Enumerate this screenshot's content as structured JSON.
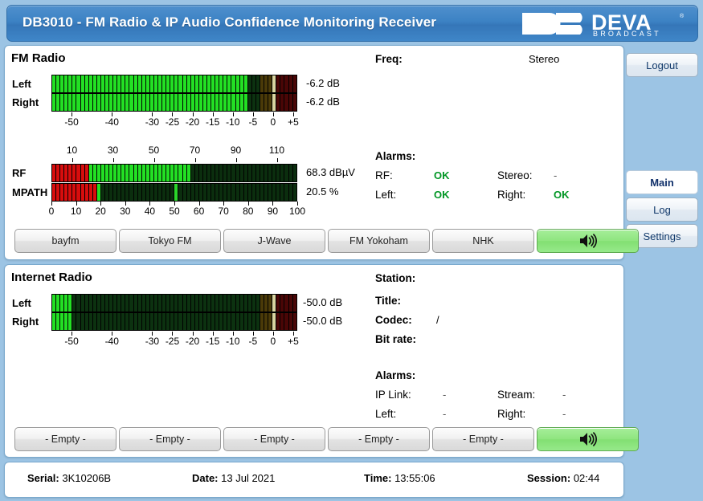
{
  "header": {
    "title": "DB3010 - FM Radio & IP Audio Confidence Monitoring Receiver",
    "logo_main": "DEVA",
    "logo_sub": "BROADCAST",
    "logo_mark": "DB",
    "accent_blue": "#3c82c4",
    "page_bg": "#9cc4e4"
  },
  "nav": {
    "logout": "Logout",
    "main": "Main",
    "log": "Log",
    "settings": "Settings"
  },
  "fm": {
    "section_title": "FM Radio",
    "left_label": "Left",
    "right_label": "Right",
    "left_value": "-6.2 dB",
    "right_value": "-6.2 dB",
    "left_db": -6.2,
    "right_db": -6.2,
    "audio_scale": {
      "min": -55,
      "max": 6,
      "ticks": [
        -50,
        -40,
        -30,
        -25,
        -20,
        -15,
        -10,
        -5,
        0,
        5
      ],
      "tick_labels": [
        "-50",
        "-40",
        "-30",
        "-25",
        "-20",
        "-15",
        "-10",
        "-5",
        "0",
        "+5"
      ]
    },
    "rf_label": "RF",
    "rf_value": "68.3 dBµV",
    "rf_number": 68.3,
    "rf_scale": {
      "min": 0,
      "max": 120,
      "ticks": [
        10,
        30,
        50,
        70,
        90,
        110
      ],
      "tick_labels": [
        "10",
        "30",
        "50",
        "70",
        "90",
        "110"
      ]
    },
    "mpath_label": "MPATH",
    "mpath_value": "20.5 %",
    "mpath_number": 20.5,
    "mpath_scale": {
      "min": 0,
      "max": 100,
      "ticks": [
        0,
        10,
        20,
        30,
        40,
        50,
        60,
        70,
        80,
        90,
        100
      ],
      "tick_labels": [
        "0",
        "10",
        "20",
        "30",
        "40",
        "50",
        "60",
        "70",
        "80",
        "90",
        "100"
      ]
    },
    "freq_label": "Freq:",
    "freq_value": "",
    "stereo_indicator": "Stereo",
    "alarms_label": "Alarms:",
    "alarms": [
      {
        "label": "RF:",
        "value": "OK",
        "state": "ok"
      },
      {
        "label": "Stereo:",
        "value": "-",
        "state": "none"
      },
      {
        "label": "Left:",
        "value": "OK",
        "state": "ok"
      },
      {
        "label": "Right:",
        "value": "OK",
        "state": "ok"
      }
    ],
    "presets": [
      "bayfm",
      "Tokyo FM",
      "J-Wave",
      "FM Yokoham",
      "NHK"
    ],
    "audio_button_icon": "speaker-icon"
  },
  "internet": {
    "section_title": "Internet Radio",
    "left_label": "Left",
    "right_label": "Right",
    "left_value": "-50.0 dB",
    "right_value": "-50.0 dB",
    "left_db": -50.0,
    "right_db": -50.0,
    "station_label": "Station:",
    "station_value": "",
    "title_label": "Title:",
    "title_value": "",
    "codec_label": "Codec:",
    "codec_value": "/",
    "bitrate_label": "Bit rate:",
    "bitrate_value": "",
    "alarms_label": "Alarms:",
    "alarms": [
      {
        "label": "IP Link:",
        "value": "-",
        "state": "none"
      },
      {
        "label": "Stream:",
        "value": "-",
        "state": "none"
      },
      {
        "label": "Left:",
        "value": "-",
        "state": "none"
      },
      {
        "label": "Right:",
        "value": "-",
        "state": "none"
      }
    ],
    "presets": [
      "- Empty -",
      "- Empty -",
      "- Empty -",
      "- Empty -",
      "- Empty -"
    ],
    "audio_button_icon": "speaker-icon"
  },
  "status": {
    "serial_label": "Serial:",
    "serial_value": "3K10206B",
    "date_label": "Date:",
    "date_value": "13 Jul 2021",
    "time_label": "Time:",
    "time_value": "13:55:06",
    "session_label": "Session:",
    "session_value": "02:44"
  },
  "colors": {
    "ok_green": "#009624",
    "meter_lit": "#22dd22",
    "meter_dark": "#0c2c0c",
    "meter_red": "#cc0000"
  }
}
